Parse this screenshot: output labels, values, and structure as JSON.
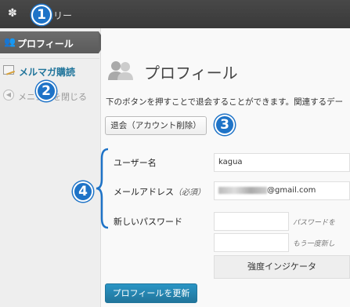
{
  "topbar": {
    "logo_icon": "wordpress-flower-icon",
    "site_label": "クベリー"
  },
  "sidebar": {
    "active_item": {
      "icon": "users-icon",
      "label": "プロフィール"
    },
    "items": [
      {
        "icon": "newsletter-icon",
        "label": "メルマガ購読"
      }
    ],
    "collapse": {
      "icon": "collapse-arrow-icon",
      "label": "メニューを閉じる"
    }
  },
  "main": {
    "title": "プロフィール",
    "title_icon": "profile-users-icon",
    "description": "下のボタンを押すことで退会することができます。関連するデー",
    "withdraw_button": "退会（アカウント削除）",
    "fields": {
      "username": {
        "label": "ユーザー名",
        "value": "kagua"
      },
      "email": {
        "label": "メールアドレス",
        "required": "（必須）",
        "value": "@gmail.com"
      },
      "password": {
        "label": "新しいパスワード",
        "hint1": "パスワードを",
        "hint2": "もう一度新し"
      }
    },
    "strength_indicator": "強度インジケータ",
    "update_button": "プロフィールを更新"
  },
  "annotations": [
    "1",
    "2",
    "3",
    "4"
  ],
  "colors": {
    "accent": "#21759b",
    "annotation": "#1e73c7",
    "admin_bar": "#464646"
  }
}
